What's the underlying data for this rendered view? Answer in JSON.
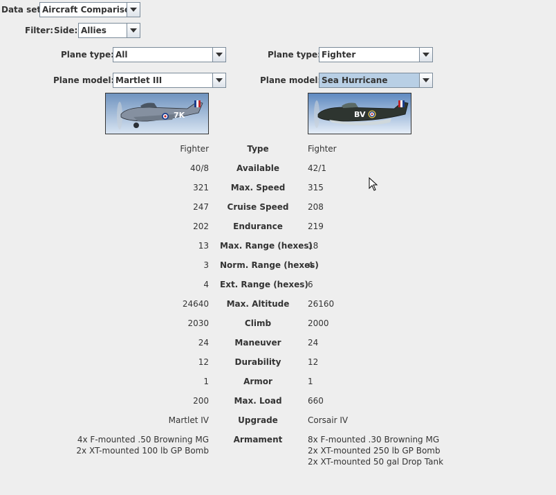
{
  "dataset": {
    "label": "Data set:",
    "value": "Aircraft Comparison"
  },
  "filter": {
    "label": "Filter:",
    "side_label": "Side:",
    "side_value": "Allies"
  },
  "left": {
    "plane_type_label": "Plane type:",
    "plane_type": "All",
    "plane_model_label": "Plane model:",
    "plane_model": "Martlet III",
    "marking": "7K"
  },
  "right": {
    "plane_type_label": "Plane type:",
    "plane_type": "Fighter",
    "plane_model_label": "Plane model:",
    "plane_model": "Sea Hurricane",
    "marking": "BV"
  },
  "stats": [
    {
      "name": "Type",
      "left": "Fighter",
      "right": "Fighter"
    },
    {
      "name": "Available",
      "left": "40/8",
      "right": "42/1"
    },
    {
      "name": "Max. Speed",
      "left": "321",
      "right": "315"
    },
    {
      "name": "Cruise Speed",
      "left": "247",
      "right": "208"
    },
    {
      "name": "Endurance",
      "left": "202",
      "right": "219"
    },
    {
      "name": "Max. Range (hexes)",
      "left": "13",
      "right": "18"
    },
    {
      "name": "Norm. Range (hexes)",
      "left": "3",
      "right": "4"
    },
    {
      "name": "Ext. Range (hexes)",
      "left": "4",
      "right": "6"
    },
    {
      "name": "Max. Altitude",
      "left": "24640",
      "right": "26160"
    },
    {
      "name": "Climb",
      "left": "2030",
      "right": "2000"
    },
    {
      "name": "Maneuver",
      "left": "24",
      "right": "24"
    },
    {
      "name": "Durability",
      "left": "12",
      "right": "12"
    },
    {
      "name": "Armor",
      "left": "1",
      "right": "1"
    },
    {
      "name": "Max. Load",
      "left": "200",
      "right": "660"
    },
    {
      "name": "Upgrade",
      "left": "Martlet IV",
      "right": "Corsair IV"
    }
  ],
  "armament": {
    "name": "Armament",
    "left": [
      "4x F-mounted .50 Browning MG",
      "2x XT-mounted 100 lb GP Bomb"
    ],
    "right": [
      "8x F-mounted .30 Browning MG",
      "2x XT-mounted 250 lb GP Bomb",
      "2x XT-mounted 50 gal Drop Tank"
    ]
  }
}
